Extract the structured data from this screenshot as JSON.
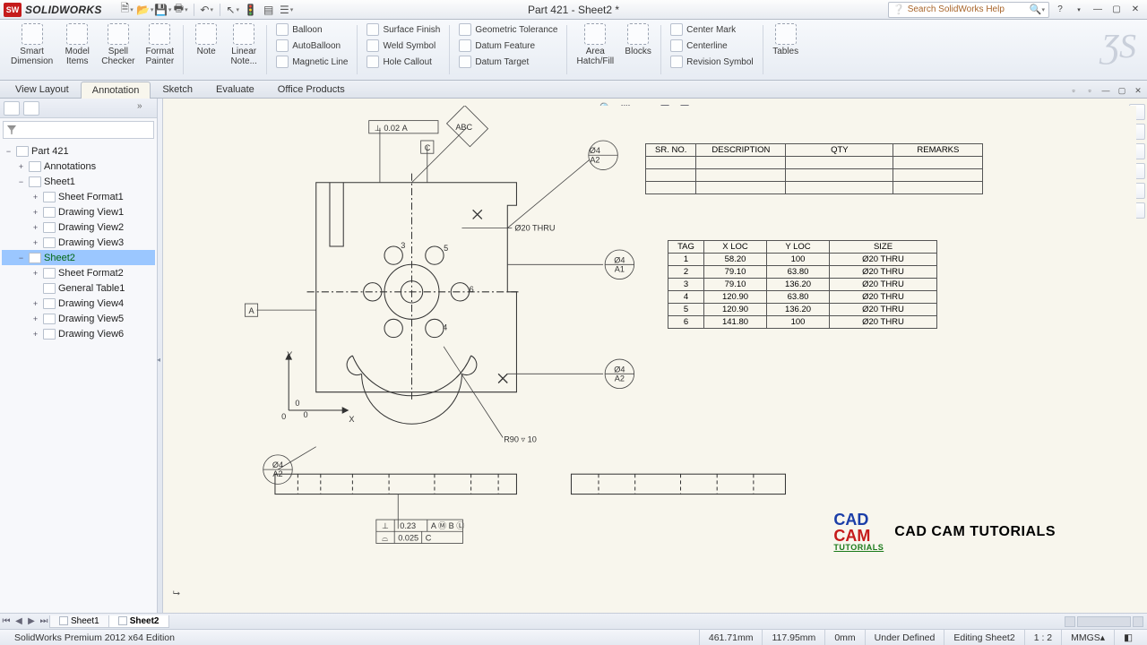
{
  "app": {
    "brand": "SOLIDWORKS",
    "title": "Part 421 - Sheet2 *"
  },
  "search": {
    "placeholder": "Search SolidWorks Help",
    "icon_q": "?"
  },
  "qat": [
    "new",
    "open",
    "save",
    "print",
    "undo",
    "select",
    "rebuild",
    "layers",
    "options"
  ],
  "ribbon": {
    "big": [
      {
        "k": "smart",
        "l1": "Smart",
        "l2": "Dimension"
      },
      {
        "k": "model",
        "l1": "Model",
        "l2": "Items"
      },
      {
        "k": "spell",
        "l1": "Spell",
        "l2": "Checker"
      },
      {
        "k": "fmt",
        "l1": "Format",
        "l2": "Painter"
      },
      {
        "k": "note",
        "l1": "Note",
        "l2": ""
      },
      {
        "k": "lnote",
        "l1": "Linear",
        "l2": "Note..."
      }
    ],
    "colA": [
      "Balloon",
      "AutoBalloon",
      "Magnetic Line"
    ],
    "colB": [
      "Surface Finish",
      "Weld Symbol",
      "Hole Callout"
    ],
    "colC": [
      "Geometric Tolerance",
      "Datum Feature",
      "Datum Target"
    ],
    "big2": [
      {
        "k": "hatch",
        "l1": "Area",
        "l2": "Hatch/Fill"
      },
      {
        "k": "blocks",
        "l1": "Blocks",
        "l2": ""
      }
    ],
    "colD": [
      "Center Mark",
      "Centerline",
      "Revision Symbol"
    ],
    "big3": [
      {
        "k": "tables",
        "l1": "Tables",
        "l2": ""
      }
    ]
  },
  "tabs": [
    "View Layout",
    "Annotation",
    "Sketch",
    "Evaluate",
    "Office Products"
  ],
  "activeTab": "Annotation",
  "tree": {
    "root": "Part 421",
    "items": [
      {
        "t": "Annotations",
        "lvl": 1,
        "tw": "+",
        "ic": "A"
      },
      {
        "t": "Sheet1",
        "lvl": 1,
        "tw": "−"
      },
      {
        "t": "Sheet Format1",
        "lvl": 2,
        "tw": "+"
      },
      {
        "t": "Drawing View1",
        "lvl": 2,
        "tw": "+"
      },
      {
        "t": "Drawing View2",
        "lvl": 2,
        "tw": "+"
      },
      {
        "t": "Drawing View3",
        "lvl": 2,
        "tw": "+"
      },
      {
        "t": "Sheet2",
        "lvl": 1,
        "tw": "−",
        "sel": true
      },
      {
        "t": "Sheet Format2",
        "lvl": 2,
        "tw": "+"
      },
      {
        "t": "General Table1",
        "lvl": 2,
        "tw": ""
      },
      {
        "t": "Drawing View4",
        "lvl": 2,
        "tw": "+"
      },
      {
        "t": "Drawing View5",
        "lvl": 2,
        "tw": "+"
      },
      {
        "t": "Drawing View6",
        "lvl": 2,
        "tw": "+"
      }
    ]
  },
  "canvas": {
    "gtol1": {
      "sym": "⊥",
      "val": "0.02",
      "datum": "A"
    },
    "datums": {
      "a": "A",
      "c": "C",
      "abc": "ABC"
    },
    "callout_thru": "Ø20 THRU",
    "callout_r": "R90 ▿ 10",
    "balloons": [
      {
        "top": "Ø4",
        "bot": "A2"
      },
      {
        "top": "Ø4",
        "bot": "A1"
      },
      {
        "top": "Ø4",
        "bot": "A2"
      },
      {
        "top": "Ø4",
        "bot": "A2"
      }
    ],
    "axis": {
      "x": "X",
      "y": "Y",
      "o": "0"
    },
    "gtol2": {
      "r1_sym": "⊥",
      "r1_val": "0.23",
      "r1_d": "A Ⓜ B Ⓛ",
      "r2_sym": "⌓",
      "r2_val": "0.025",
      "r2_d": "C"
    },
    "hole_nums": [
      "3",
      "5",
      "6",
      "4"
    ]
  },
  "tbl1": {
    "headers": [
      "SR. NO.",
      "DESCRIPTION",
      "QTY",
      "REMARKS"
    ],
    "rows": 3
  },
  "tbl2": {
    "headers": [
      "TAG",
      "X LOC",
      "Y LOC",
      "SIZE"
    ],
    "rows": [
      [
        "1",
        "58.20",
        "100",
        "Ø20 THRU"
      ],
      [
        "2",
        "79.10",
        "63.80",
        "Ø20 THRU"
      ],
      [
        "3",
        "79.10",
        "136.20",
        "Ø20 THRU"
      ],
      [
        "4",
        "120.90",
        "63.80",
        "Ø20 THRU"
      ],
      [
        "5",
        "120.90",
        "136.20",
        "Ø20 THRU"
      ],
      [
        "6",
        "141.80",
        "100",
        "Ø20 THRU"
      ]
    ]
  },
  "watermark": {
    "cad": "CAD",
    "cam": "CAM",
    "tut": "TUTORIALS",
    "txt": "CAD CAM TUTORIALS"
  },
  "sheetTabs": [
    "Sheet1",
    "Sheet2"
  ],
  "activeSheet": "Sheet2",
  "status": {
    "edition": "SolidWorks Premium 2012 x64 Edition",
    "x": "461.71mm",
    "y": "117.95mm",
    "z": "0mm",
    "def": "Under Defined",
    "edit": "Editing Sheet2",
    "scale": "1 : 2",
    "units": "MMGS"
  }
}
